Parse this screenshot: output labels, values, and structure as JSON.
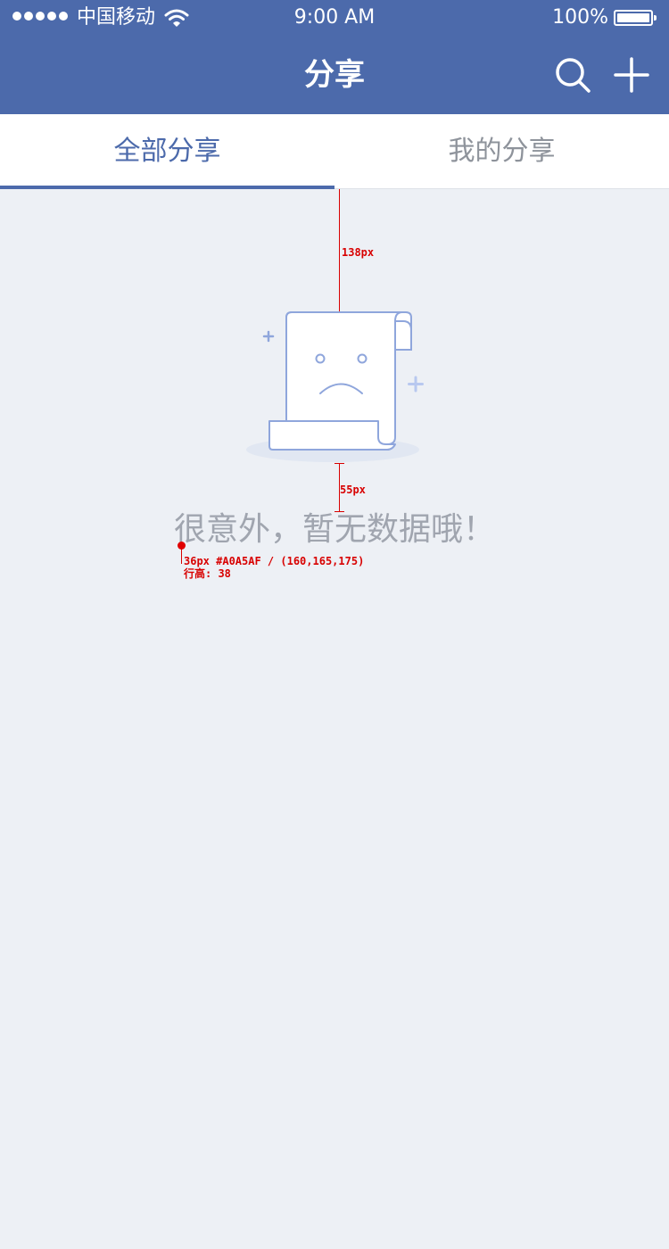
{
  "status_bar": {
    "carrier": "中国移动",
    "time": "9:00 AM",
    "battery": "100%",
    "signal_icon": "signal-dots-icon",
    "wifi_icon": "wifi-icon",
    "battery_icon": "battery-icon"
  },
  "nav": {
    "title": "分享",
    "search_icon": "search-icon",
    "add_icon": "plus-icon",
    "background_color": "#4c6aab"
  },
  "tabs": [
    {
      "label": "全部分享",
      "active": true
    },
    {
      "label": "我的分享",
      "active": false
    }
  ],
  "empty_state": {
    "icon": "sad-document-icon",
    "message": "很意外，暂无数据哦！",
    "text_color": "#A0A5AF"
  },
  "annotations": {
    "top_spacing": "138px",
    "bottom_spacing": "55px",
    "font_spec": "36px #A0A5AF / (160,165,175)",
    "line_height": "行高: 38"
  }
}
